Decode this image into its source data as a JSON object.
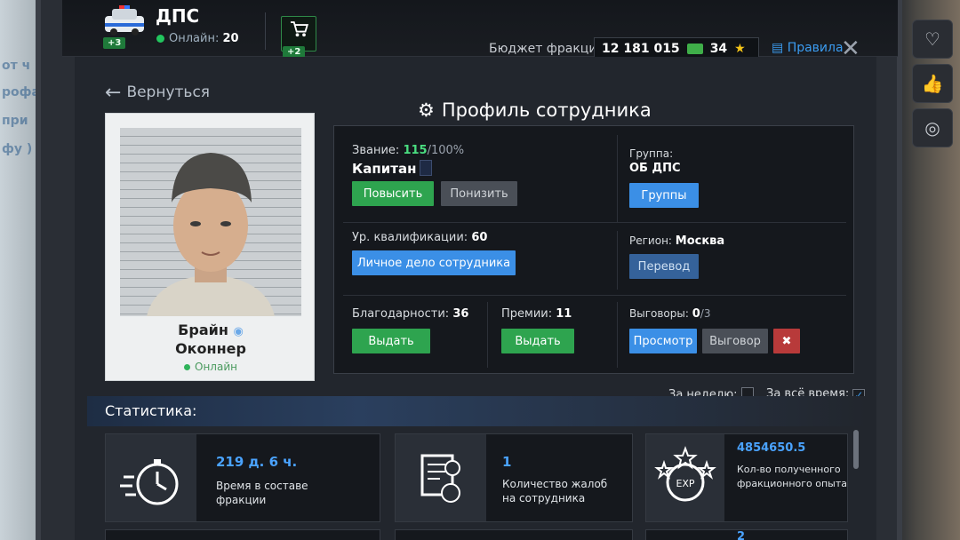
{
  "header": {
    "faction_name": "ДПС",
    "faction_badge": "+3",
    "online_label": "Онлайн:",
    "online_count": "20",
    "cart_badge": "+2",
    "budget_label": "Бюджет фракции:",
    "budget_value": "12 181 015",
    "stars_value": "34",
    "rules_label": "Правила",
    "accent_green": "#2ea44f",
    "accent_blue": "#3b8fe6"
  },
  "nav": {
    "back_label": "Вернуться",
    "page_title": "Профиль сотрудника"
  },
  "profile": {
    "first_name": "Брайн",
    "last_name": "Оконнер",
    "status": "Онлайн"
  },
  "rank": {
    "label": "Звание:",
    "current": "115",
    "max": "/100%",
    "title": "Капитан",
    "promote_label": "Повысить",
    "demote_label": "Понизить"
  },
  "group": {
    "label": "Группа:",
    "value": "ОБ ДПС",
    "button_label": "Группы"
  },
  "qualification": {
    "label": "Ур. квалификации:",
    "value": "60",
    "button_label": "Личное дело сотрудника"
  },
  "region": {
    "label": "Регион:",
    "value": "Москва",
    "button_label": "Перевод"
  },
  "thanks": {
    "label": "Благодарности:",
    "value": "36",
    "button_label": "Выдать"
  },
  "bonuses": {
    "label": "Премии:",
    "value": "11",
    "button_label": "Выдать"
  },
  "reprimands": {
    "label": "Выговоры:",
    "value": "0",
    "max": "/3",
    "view_label": "Просмотр",
    "issue_label": "Выговор"
  },
  "filters": {
    "week_label": "За неделю:",
    "week_checked": false,
    "all_time_label": "За всё время:",
    "all_time_checked": true
  },
  "stats": {
    "title": "Статистика:",
    "cards": [
      {
        "value": "219 д. 6 ч.",
        "label_line1": "Время в составе",
        "label_line2": "фракции",
        "icon": "stopwatch-icon"
      },
      {
        "value": "1",
        "label_line1": "Количество жалоб",
        "label_line2": "на сотрудника",
        "icon": "complaint-document-icon"
      },
      {
        "value": "4854650.5",
        "label_line1": "Кол-во полученного",
        "label_line2": "фракционного опыта",
        "icon": "exp-stars-icon"
      }
    ],
    "partial_value": "2"
  }
}
